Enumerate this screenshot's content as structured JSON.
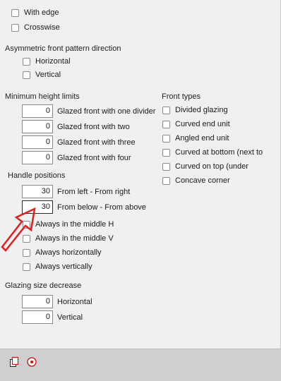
{
  "top_options": [
    {
      "label": "With edge",
      "checked": false
    },
    {
      "label": "Crosswise",
      "checked": false
    }
  ],
  "asymmetric": {
    "title": "Asymmetric front pattern direction",
    "options": [
      {
        "label": "Horizontal",
        "checked": false
      },
      {
        "label": "Vertical",
        "checked": false
      }
    ]
  },
  "min_height": {
    "title": "Minimum height limits",
    "rows": [
      {
        "value": "0",
        "label": "Glazed front with one divider"
      },
      {
        "value": "0",
        "label": "Glazed front with two"
      },
      {
        "value": "0",
        "label": "Glazed front with three"
      },
      {
        "value": "0",
        "label": "Glazed front with four"
      }
    ]
  },
  "front_types": {
    "title": "Front types",
    "options": [
      {
        "label": "Divided glazing",
        "checked": false
      },
      {
        "label": "Curved end unit",
        "checked": false
      },
      {
        "label": "Angled end unit",
        "checked": false
      },
      {
        "label": "Curved at bottom (next to",
        "checked": false
      },
      {
        "label": "Curved on top (under",
        "checked": false
      },
      {
        "label": "Concave corner",
        "checked": false
      }
    ]
  },
  "handle_positions": {
    "title": "Handle positions",
    "rows": [
      {
        "value": "30",
        "label": "From left - From right"
      },
      {
        "value": "30",
        "label": "From below - From above"
      }
    ],
    "options": [
      {
        "label": "Always in the middle H",
        "checked": false
      },
      {
        "label": "Always in the middle V",
        "checked": false
      },
      {
        "label": "Always horizontally",
        "checked": false
      },
      {
        "label": "Always vertically",
        "checked": false
      }
    ]
  },
  "glazing": {
    "title": "Glazing size decrease",
    "rows": [
      {
        "value": "0",
        "label": "Horizontal"
      },
      {
        "value": "0",
        "label": "Vertical"
      }
    ]
  },
  "toolbar": {
    "icons": [
      "copy-icon",
      "target-icon"
    ]
  },
  "colors": {
    "arrow": "#e02020",
    "panel": "#f0f0f0",
    "bottombar": "#cfcfcf"
  }
}
